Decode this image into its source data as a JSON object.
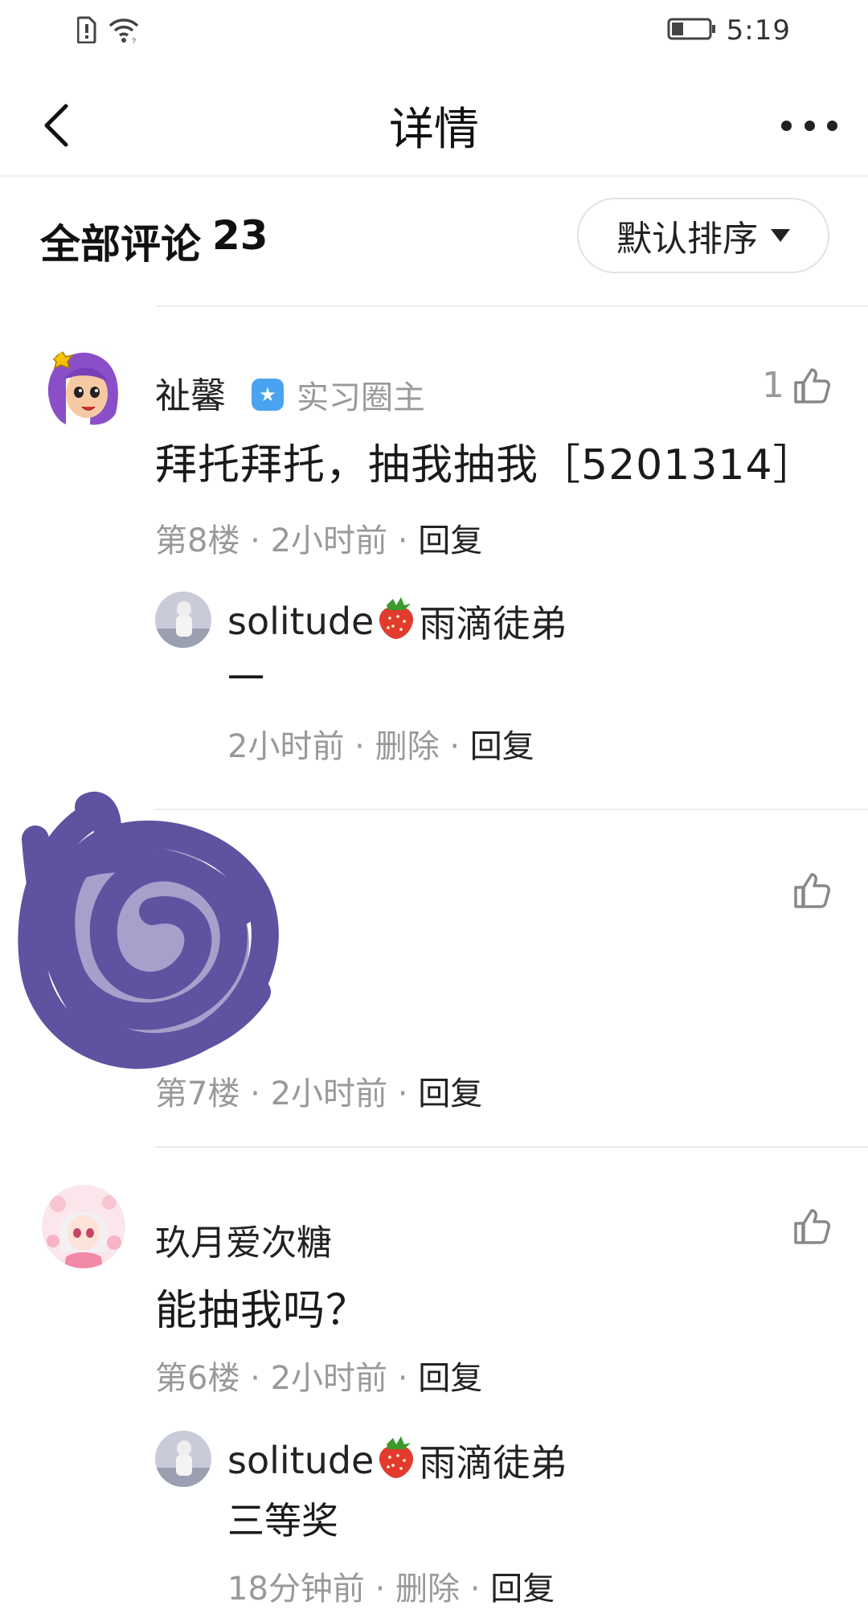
{
  "status_bar": {
    "time": "5:19"
  },
  "nav": {
    "title": "详情"
  },
  "section": {
    "heading": "全部评论",
    "count": "23",
    "sort_label": "默认排序"
  },
  "comments": [
    {
      "user": "祉馨",
      "badge": "实习圈主",
      "text": "拜托拜托，抽我抽我［5201314］",
      "floor": "第8楼",
      "time": "2小时前",
      "reply_action": "回复",
      "likes": "1",
      "replies": [
        {
          "user_pre": "solitude",
          "user_post": "雨滴徒弟",
          "text": "一",
          "time": "2小时前",
          "delete_action": "删除",
          "reply_action": "回复"
        }
      ]
    },
    {
      "user": "",
      "text": "",
      "floor": "第7楼",
      "time": "2小时前",
      "reply_action": "回复",
      "likes": ""
    },
    {
      "user": "玖月爱次糖",
      "text": "能抽我吗？",
      "floor": "第6楼",
      "time": "2小时前",
      "reply_action": "回复",
      "likes": "",
      "replies": [
        {
          "user_pre": "solitude",
          "user_post": "雨滴徒弟",
          "text": "三等奖",
          "time": "18分钟前",
          "delete_action": "删除",
          "reply_action": "回复"
        }
      ]
    }
  ],
  "colors": {
    "redaction": "#5f52a0",
    "badge_blue": "#4aa3f0",
    "muted_text": "#999999"
  }
}
